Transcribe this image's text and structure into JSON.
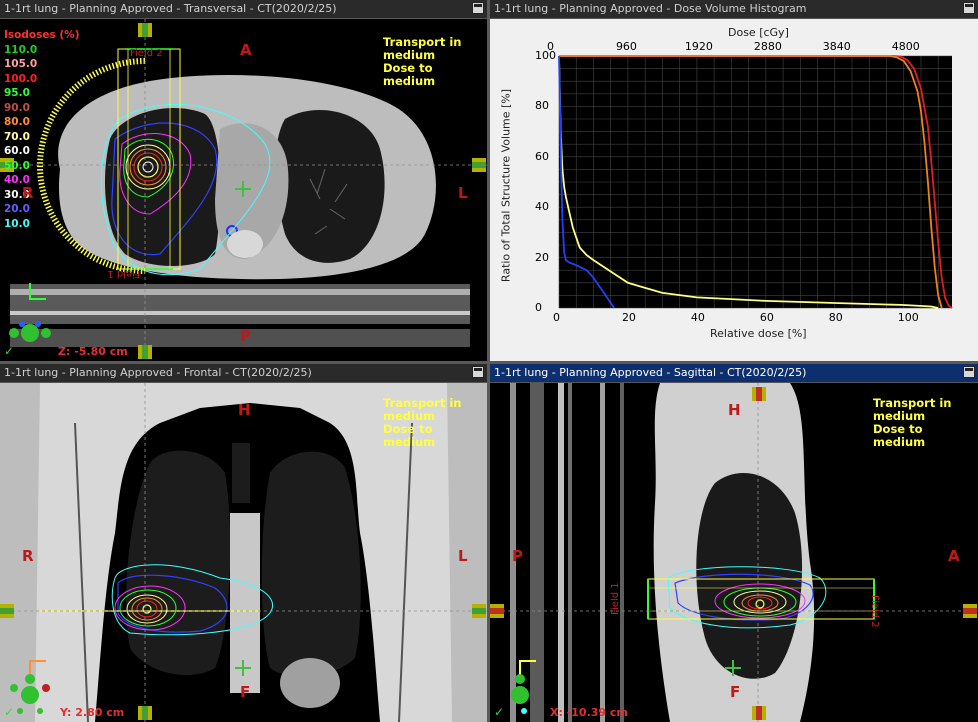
{
  "transversal": {
    "title": "1-1rt lung  -  Planning Approved - Transversal - CT(2020/2/25)",
    "orient": {
      "top": "A",
      "bottom": "P",
      "left": "R",
      "right": "L"
    },
    "transport_lines": [
      "Transport in",
      "medium",
      "Dose to medium"
    ],
    "coord": "Z: -5.80 cm",
    "check": "✓",
    "isodoses_header": "Isodoses (%)",
    "isodoses": [
      {
        "label": "110.0",
        "color": "#20d020"
      },
      {
        "label": "105.0",
        "color": "#ffa0a0"
      },
      {
        "label": "100.0",
        "color": "#ff2020"
      },
      {
        "label": "95.0",
        "color": "#30ff30"
      },
      {
        "label": "90.0",
        "color": "#c05050"
      },
      {
        "label": "80.0",
        "color": "#ff9030"
      },
      {
        "label": "70.0",
        "color": "#ffffa0"
      },
      {
        "label": "60.0",
        "color": "#ffffff"
      },
      {
        "label": "50.0",
        "color": "#30ff30"
      },
      {
        "label": "40.0",
        "color": "#ff30ff"
      },
      {
        "label": "30.0",
        "color": "#ffffff"
      },
      {
        "label": "20.0",
        "color": "#6060ff"
      },
      {
        "label": "10.0",
        "color": "#40ffff"
      }
    ],
    "field_labels": [
      "Field 2",
      "Field 1"
    ]
  },
  "dvh": {
    "title": "1-1rt lung  -  Planning Approved - Dose Volume Histogram",
    "top_axis_label": "Dose [cGy]",
    "bottom_axis_label": "Relative dose [%]",
    "y_axis_label": "Ratio of Total Structure Volume [%]",
    "top_ticks": [
      "0",
      "960",
      "1920",
      "2880",
      "3840",
      "4800"
    ],
    "bottom_ticks": [
      "0",
      "20",
      "40",
      "60",
      "80",
      "100"
    ],
    "y_ticks": [
      "0",
      "20",
      "40",
      "60",
      "80",
      "100"
    ]
  },
  "chart_data": {
    "type": "line",
    "xlabel": "Relative dose [%]",
    "ylabel": "Ratio of Total Structure Volume [%]",
    "x2label": "Dose [cGy]",
    "xlim": [
      0,
      114
    ],
    "ylim": [
      0,
      100
    ],
    "grid": true,
    "series": [
      {
        "color": "#e02020",
        "x": [
          0,
          97,
          99,
          101,
          103,
          105,
          107,
          108,
          109,
          110,
          111,
          112,
          113,
          114
        ],
        "y": [
          100,
          100,
          99.8,
          98.5,
          95,
          87,
          72,
          58,
          42,
          26,
          12,
          4,
          1,
          0
        ]
      },
      {
        "color": "#f08020",
        "x": [
          0,
          96,
          98,
          100,
          102,
          104,
          105,
          106,
          107,
          108,
          109,
          110,
          111
        ],
        "y": [
          100,
          100,
          99.5,
          98,
          94,
          86,
          78,
          66,
          50,
          32,
          16,
          5,
          0
        ]
      },
      {
        "color": "#ffff80",
        "x": [
          0,
          0.5,
          1,
          1.5,
          2,
          3,
          4,
          5,
          6,
          8,
          10,
          15,
          20,
          30,
          40,
          60,
          80,
          100,
          108,
          110
        ],
        "y": [
          100,
          70,
          55,
          48,
          44,
          38,
          32,
          28,
          24,
          21,
          19,
          14.5,
          10,
          6,
          4.2,
          2.8,
          2,
          1.2,
          0.6,
          0
        ]
      },
      {
        "color": "#2040ff",
        "x": [
          0,
          0.3,
          0.6,
          1,
          1.5,
          2,
          3,
          5,
          8,
          10,
          12,
          14,
          15,
          16
        ],
        "y": [
          100,
          80,
          55,
          35,
          22,
          19,
          18,
          17,
          15,
          12,
          8,
          4,
          2,
          0
        ]
      }
    ]
  },
  "frontal": {
    "title": "1-1rt lung  -  Planning Approved - Frontal - CT(2020/2/25)",
    "orient": {
      "top": "H",
      "bottom": "F",
      "left": "R",
      "right": "L"
    },
    "transport_lines": [
      "Transport in",
      "medium",
      "Dose to medium"
    ],
    "coord": "Y: 2.80 cm",
    "check": "✓"
  },
  "sagittal": {
    "title": "1-1rt lung  -  Planning Approved - Sagittal - CT(2020/2/25)",
    "orient": {
      "top": "H",
      "bottom": "F",
      "left": "P",
      "right": "A"
    },
    "transport_lines": [
      "Transport in",
      "medium",
      "Dose to medium"
    ],
    "coord": "X: -10.39 cm",
    "check": "✓",
    "field_labels": [
      "Field 1",
      "Field 2"
    ]
  }
}
